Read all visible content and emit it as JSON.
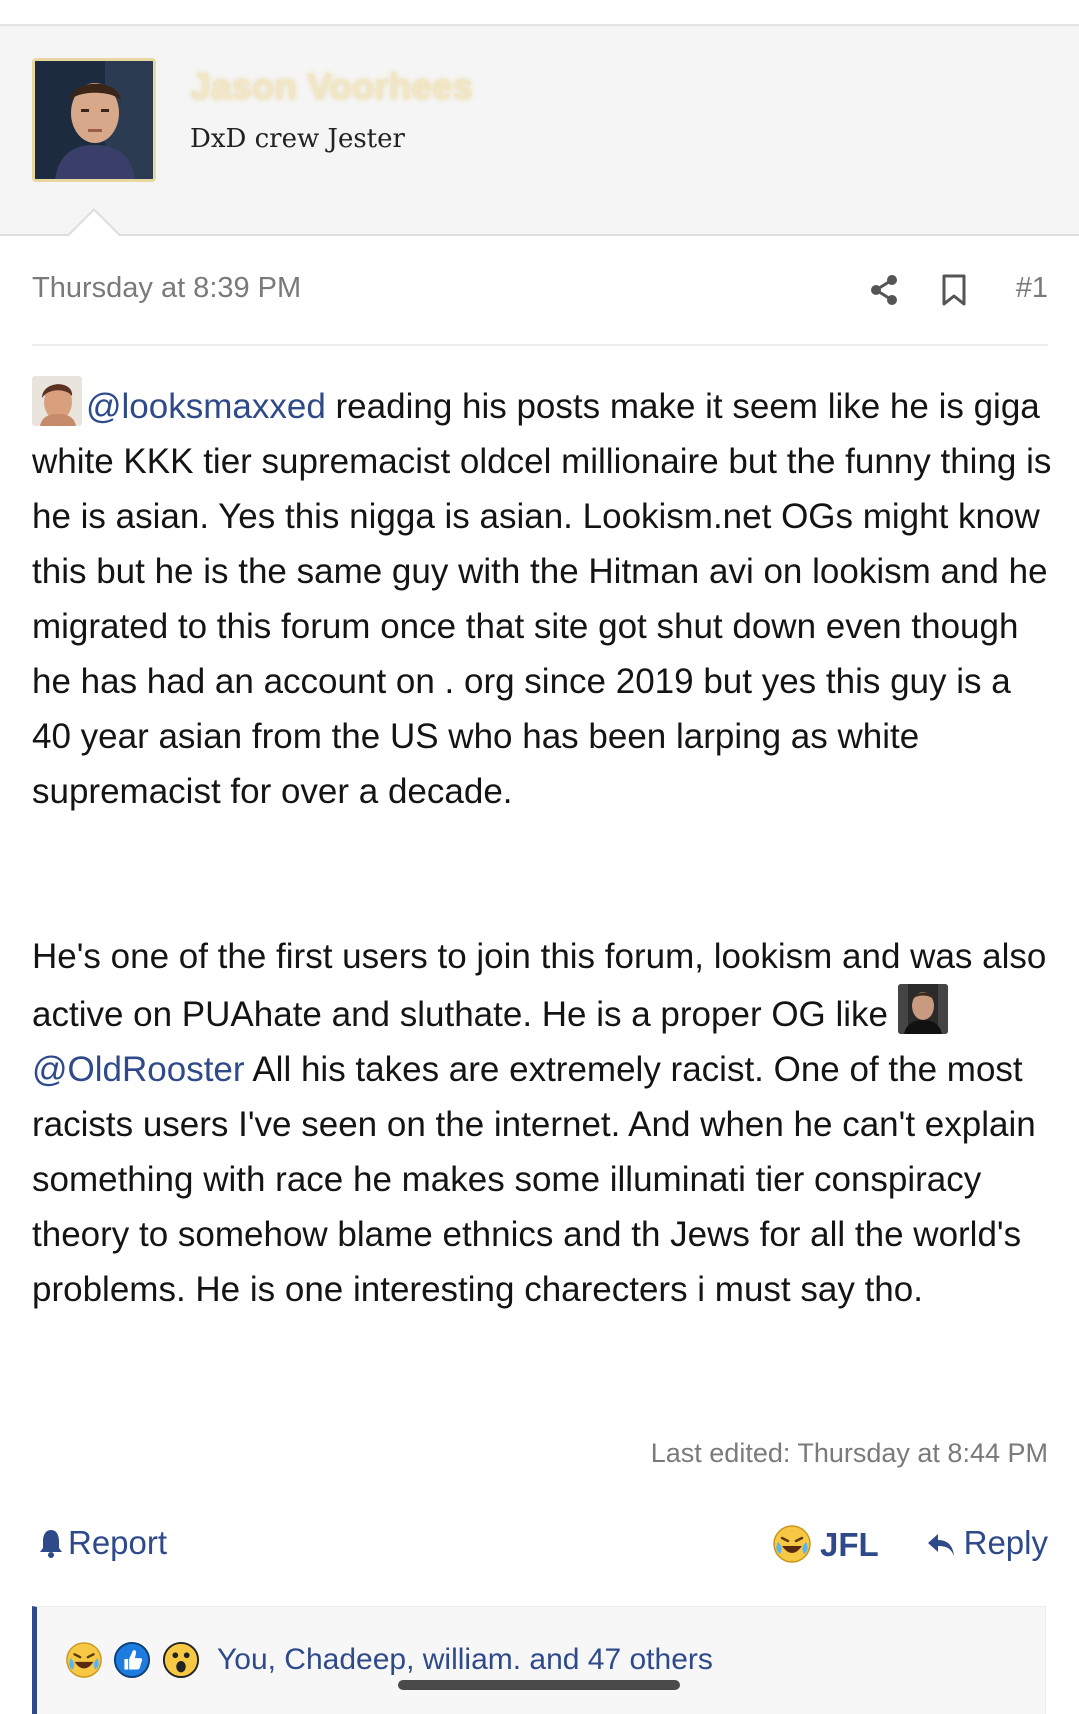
{
  "user": {
    "name": "Jason Voorhees",
    "title": "DxD crew Jester"
  },
  "post": {
    "timestamp": "Thursday at 8:39 PM",
    "number": "#1",
    "para1": {
      "mention": "@looksmaxxed",
      "text": " reading his posts make it seem like he is giga white KKK tier supremacist oldcel millionaire but the funny thing is he is asian. Yes this nigga is asian. Lookism.net OGs might know this but he is the same guy with the Hitman avi on lookism and he migrated to this forum once that site got shut down even though he has had an account on . org since 2019 but yes this guy is a 40 year asian from the US who has been larping as white supremacist for over a decade."
    },
    "para2": {
      "before": "He's one of the first users to join this forum, lookism and was also active on PUAhate and sluthate. He is a proper OG like ",
      "mention": "@OldRooster",
      "after": " All his takes are extremely racist. One of the most racists users I've seen on the internet. And when he can't explain something with race he makes some illuminati tier conspiracy theory to somehow blame ethnics and th Jews for all the world's problems. He is one interesting charecters i must say tho."
    },
    "last_edited": "Last edited: Thursday at 8:44 PM"
  },
  "actions": {
    "report": "Report",
    "react": "JFL",
    "reply": "Reply"
  },
  "reactions": {
    "summary": "You, Chadeep, william. and 47 others",
    "icons": [
      "laughing-crying-icon",
      "thumbs-up-icon",
      "shocked-face-icon"
    ]
  },
  "colors": {
    "link": "#2f4a8a",
    "username_glow": "#f1e6c6",
    "muted": "#7a7a7a"
  }
}
